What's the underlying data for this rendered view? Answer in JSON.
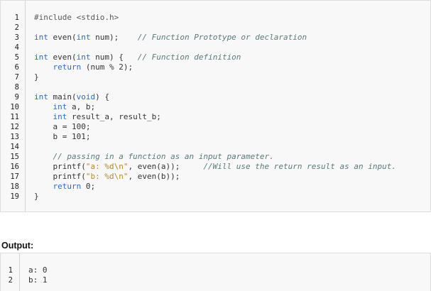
{
  "code": {
    "line_numbers": [
      "1",
      "2",
      "3",
      "4",
      "5",
      "6",
      "7",
      "8",
      "9",
      "10",
      "11",
      "12",
      "13",
      "14",
      "15",
      "16",
      "17",
      "18",
      "19"
    ],
    "lines": [
      [
        {
          "t": "#include <stdio.h>",
          "c": "inc"
        }
      ],
      [],
      [
        {
          "t": "int",
          "c": "kw"
        },
        {
          "t": " even(",
          "c": ""
        },
        {
          "t": "int",
          "c": "kw"
        },
        {
          "t": " num);    ",
          "c": ""
        },
        {
          "t": "// Function Prototype or declaration",
          "c": "cm"
        }
      ],
      [],
      [
        {
          "t": "int",
          "c": "kw"
        },
        {
          "t": " even(",
          "c": ""
        },
        {
          "t": "int",
          "c": "kw"
        },
        {
          "t": " num) {   ",
          "c": ""
        },
        {
          "t": "// Function definition",
          "c": "cm"
        }
      ],
      [
        {
          "t": "    ",
          "c": ""
        },
        {
          "t": "return",
          "c": "kw"
        },
        {
          "t": " (num % 2);",
          "c": ""
        }
      ],
      [
        {
          "t": "}",
          "c": ""
        }
      ],
      [],
      [
        {
          "t": "int",
          "c": "kw"
        },
        {
          "t": " main(",
          "c": ""
        },
        {
          "t": "void",
          "c": "kw"
        },
        {
          "t": ") {",
          "c": ""
        }
      ],
      [
        {
          "t": "    ",
          "c": ""
        },
        {
          "t": "int",
          "c": "kw"
        },
        {
          "t": " a, b;",
          "c": ""
        }
      ],
      [
        {
          "t": "    ",
          "c": ""
        },
        {
          "t": "int",
          "c": "kw"
        },
        {
          "t": " result_a, result_b;",
          "c": ""
        }
      ],
      [
        {
          "t": "    a = 100;",
          "c": ""
        }
      ],
      [
        {
          "t": "    b = 101;",
          "c": ""
        }
      ],
      [],
      [
        {
          "t": "    ",
          "c": ""
        },
        {
          "t": "// passing in a function as an input parameter.",
          "c": "cm"
        }
      ],
      [
        {
          "t": "    printf(",
          "c": ""
        },
        {
          "t": "\"a: %d\\n\"",
          "c": "st"
        },
        {
          "t": ", even(a));     ",
          "c": ""
        },
        {
          "t": "//Will use the return result as an input.",
          "c": "cm"
        }
      ],
      [
        {
          "t": "    printf(",
          "c": ""
        },
        {
          "t": "\"b: %d\\n\"",
          "c": "st"
        },
        {
          "t": ", even(b));",
          "c": ""
        }
      ],
      [
        {
          "t": "    ",
          "c": ""
        },
        {
          "t": "return",
          "c": "kw"
        },
        {
          "t": " 0;",
          "c": ""
        }
      ],
      [
        {
          "t": "}",
          "c": ""
        }
      ]
    ]
  },
  "output": {
    "title": "Output:",
    "line_numbers": [
      "1",
      "2"
    ],
    "lines": [
      "a: 0",
      "b: 1"
    ]
  }
}
